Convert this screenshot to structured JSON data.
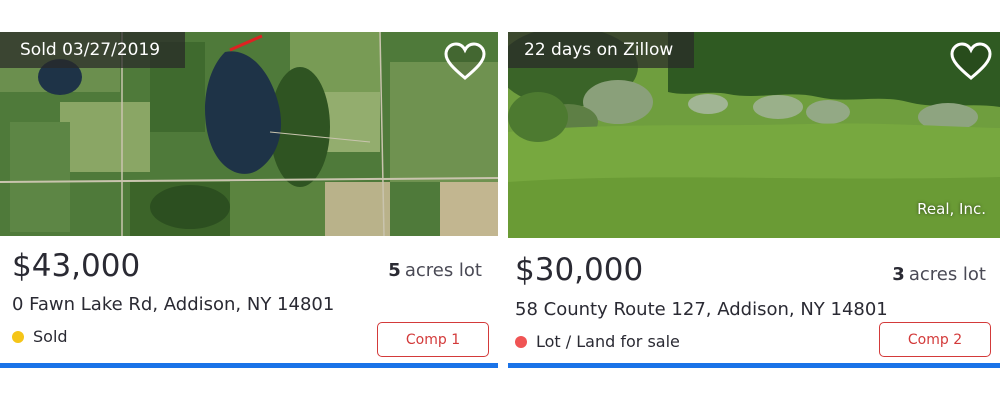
{
  "cards": [
    {
      "tag": "Sold 03/27/2019",
      "price": "$43,000",
      "lot_num": "5",
      "lot_unit": "acres lot",
      "address": "0 Fawn Lake Rd, Addison, NY 14801",
      "status": "Sold",
      "status_color": "#f5c518",
      "comp_label": "Comp 1",
      "photo_kind": "aerial-lake-farmland"
    },
    {
      "tag": "22 days on Zillow",
      "price": "$30,000",
      "lot_num": "3",
      "lot_unit": "acres lot",
      "address": "58 County Route 127, Addison, NY 14801",
      "status": "Lot / Land for sale",
      "status_color": "#f05454",
      "comp_label": "Comp 2",
      "attribution": "Real, Inc.",
      "photo_kind": "grass-field-shrubs"
    }
  ],
  "colors": {
    "accent_bar": "#1a73e8",
    "comp_border": "#d33a3a"
  },
  "icons": {
    "favorite": "heart-outline-icon"
  }
}
